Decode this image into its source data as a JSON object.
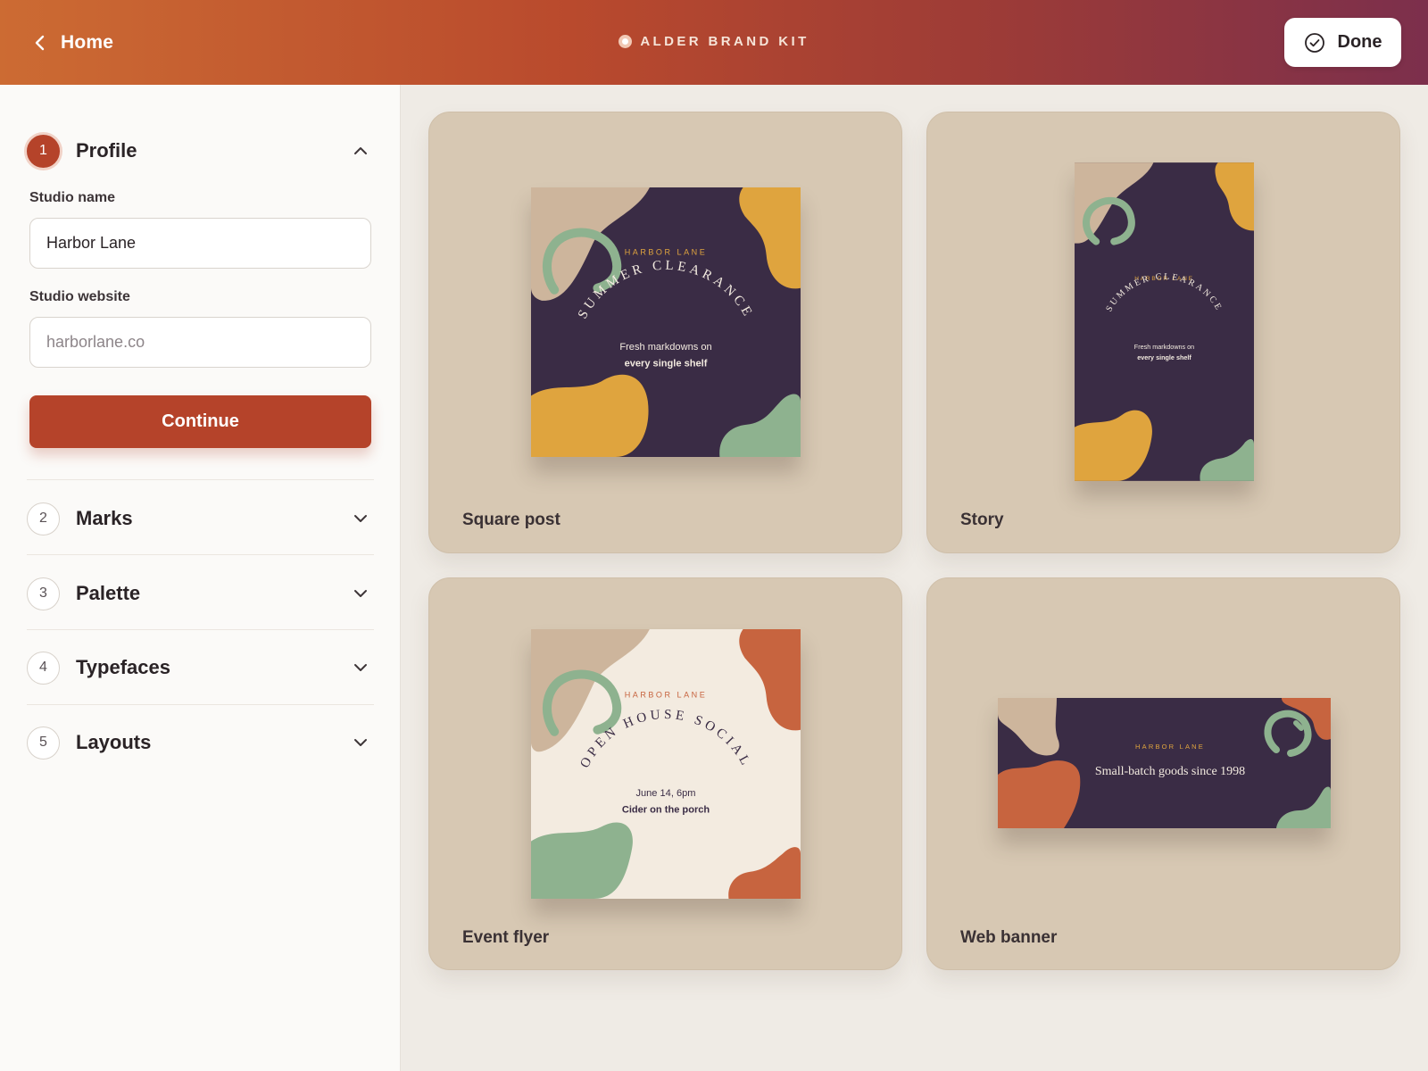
{
  "header": {
    "back_label": "Home",
    "app_title": "ALDER BRAND KIT",
    "done_label": "Done"
  },
  "sidebar": {
    "steps": [
      {
        "number": "1",
        "label": "Profile",
        "expanded": true
      },
      {
        "number": "2",
        "label": "Marks",
        "expanded": false
      },
      {
        "number": "3",
        "label": "Palette",
        "expanded": false
      },
      {
        "number": "4",
        "label": "Typefaces",
        "expanded": false
      },
      {
        "number": "5",
        "label": "Layouts",
        "expanded": false
      }
    ],
    "profile": {
      "studio_name_label": "Studio name",
      "studio_name_value": "Harbor Lane",
      "studio_website_label": "Studio website",
      "studio_website_placeholder": "harborlane.co",
      "continue_label": "Continue"
    }
  },
  "previews": [
    {
      "label": "Square post",
      "brand": "HARBOR LANE",
      "headline": "SUMMER CLEARANCE",
      "line1": "Fresh markdowns on",
      "line2": "every single shelf"
    },
    {
      "label": "Story",
      "brand": "HARBOR LANE",
      "headline": "SUMMER CLEARANCE",
      "line1": "Fresh markdowns on",
      "line2": "every single shelf"
    },
    {
      "label": "Event flyer",
      "brand": "HARBOR LANE",
      "headline": "OPEN HOUSE SOCIAL",
      "line1": "June 14, 6pm",
      "line2": "Cider on the porch"
    },
    {
      "label": "Web banner",
      "brand": "HARBOR LANE",
      "tagline": "Small-batch goods since 1998"
    }
  ],
  "colors": {
    "accent": "#b5432a",
    "plum": "#3a2c45",
    "mustard": "#dfa43e",
    "sage": "#8eb28f",
    "sand": "#cdb59c",
    "terracotta": "#c7643f",
    "cream": "#f3ebe0",
    "card_bg": "#d7c8b3"
  }
}
